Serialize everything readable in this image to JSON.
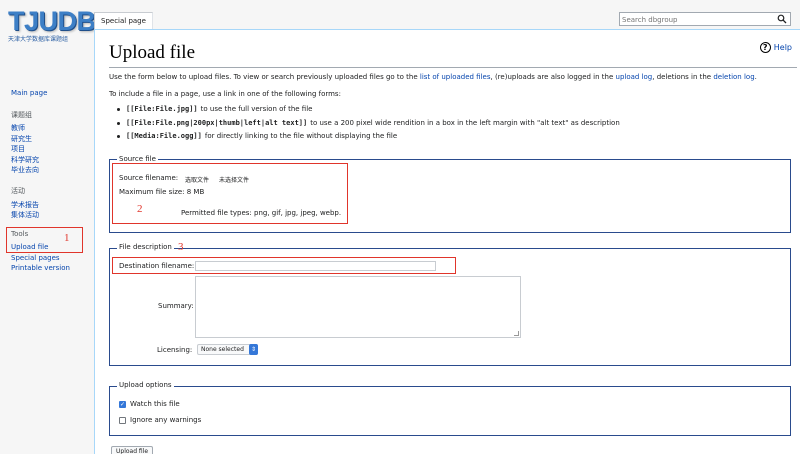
{
  "logo": {
    "title": "TJUDB",
    "subtitle": "天津大学数据库课题组"
  },
  "sidebar": {
    "main_page": "Main page",
    "group1_heading": "课题组",
    "group1_items": [
      "教师",
      "研究生",
      "项目",
      "科学研究",
      "毕业去向"
    ],
    "group2_heading": "活动",
    "group2_items": [
      "学术报告",
      "集体活动"
    ],
    "tools_heading": "Tools",
    "tools_items": [
      "Upload file",
      "Special pages",
      "Printable version"
    ]
  },
  "tabs": {
    "special_page": "Special page"
  },
  "search": {
    "placeholder": "Search dbgroup"
  },
  "page": {
    "title": "Upload file",
    "help": "Help",
    "intro_1": "Use the form below to upload files. To view or search previously uploaded files go to the",
    "intro_link_1": "list of uploaded files",
    "intro_2": ", (re)uploads are also logged in the",
    "intro_link_2": "upload log",
    "intro_3": ", deletions in the",
    "intro_link_3": "deletion log",
    "intro_4": ".",
    "include_text": "To include a file in a page, use a link in one of the following forms:",
    "forms": [
      {
        "code": "[[File:File.jpg]]",
        "desc": "to use the full version of the file"
      },
      {
        "code": "[[File:File.png|200px|thumb|left|alt text]]",
        "desc": "to use a 200 pixel wide rendition in a box in the left margin with \"alt text\" as description"
      },
      {
        "code": "[[Media:File.ogg]]",
        "desc": "for directly linking to the file without displaying the file"
      }
    ]
  },
  "source_file": {
    "legend": "Source file",
    "filename_label": "Source filename:",
    "choose_button": "选取文件",
    "no_file": "未选择文件",
    "max_size": "Maximum file size: 8 MB",
    "permitted": "Permitted file types: png, gif, jpg, jpeg, webp."
  },
  "file_description": {
    "legend": "File description",
    "destination_label": "Destination filename:",
    "destination_value": "",
    "summary_label": "Summary:",
    "licensing_label": "Licensing:",
    "licensing_value": "None selected"
  },
  "upload_options": {
    "legend": "Upload options",
    "watch_label": "Watch this file",
    "watch_checked": true,
    "ignore_label": "Ignore any warnings",
    "ignore_checked": false
  },
  "upload_button": "Upload file",
  "annotations": [
    "1",
    "2",
    "3"
  ],
  "colors": {
    "link": "#0645ad",
    "annotation_red": "#e0352b",
    "accent": "#3477d8",
    "fieldset_border": "#2a4b8d"
  }
}
